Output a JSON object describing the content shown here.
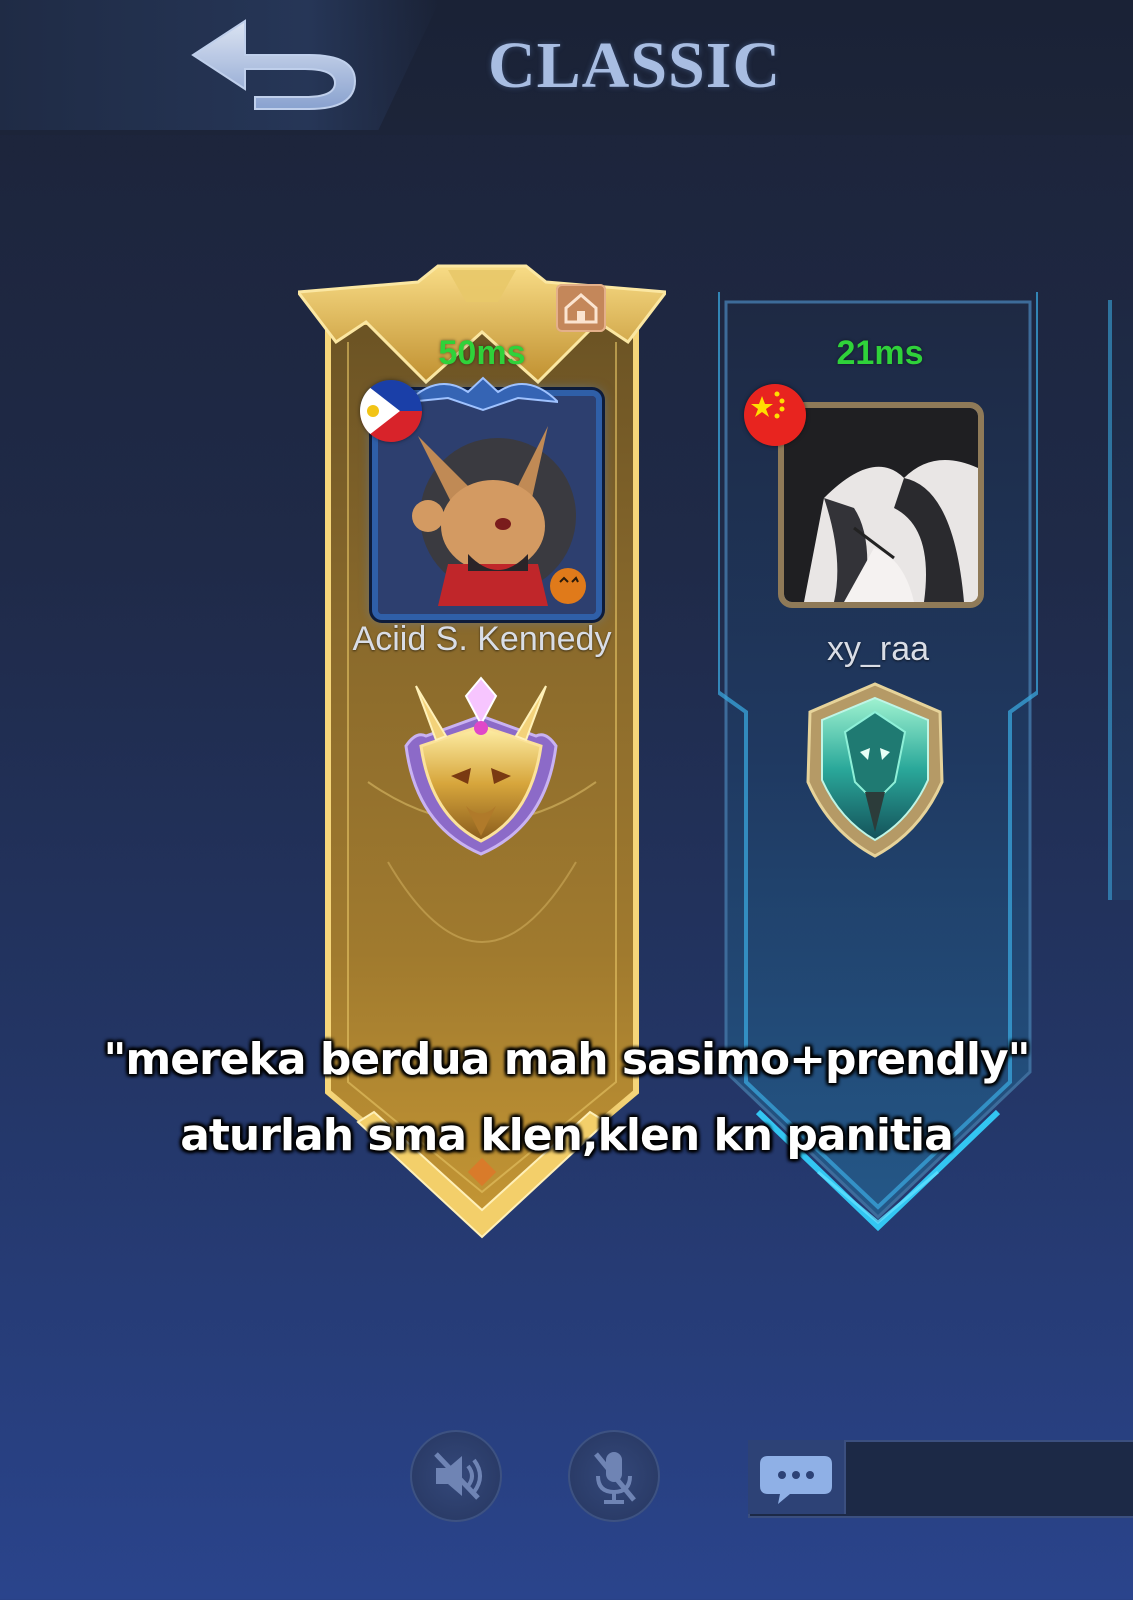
{
  "header": {
    "title": "CLASSIC",
    "back_icon": "back-arrow-icon"
  },
  "players": [
    {
      "ping": "50ms",
      "name": "Aciid S. Kennedy",
      "flag": "philippines-flag",
      "banner_color": "#c9a24a",
      "badge_icon": "home-icon",
      "rank_icon": "gold-dragon-rank-emblem"
    },
    {
      "ping": "21ms",
      "name": "xy_raa",
      "flag": "china-flag",
      "banner_color": "#2fa3d6",
      "rank_icon": "teal-dragon-rank-emblem"
    }
  ],
  "subtitle": {
    "line1": "\"mereka berdua mah sasimo+prendly\"",
    "line2": "aturlah sma klen,klen kn panitia"
  },
  "controls": {
    "speaker_icon": "speaker-muted-icon",
    "mic_icon": "mic-muted-icon",
    "chat_icon": "chat-bubble-icon"
  },
  "colors": {
    "ping": "#2fd23a",
    "title": "#a8bde2"
  }
}
